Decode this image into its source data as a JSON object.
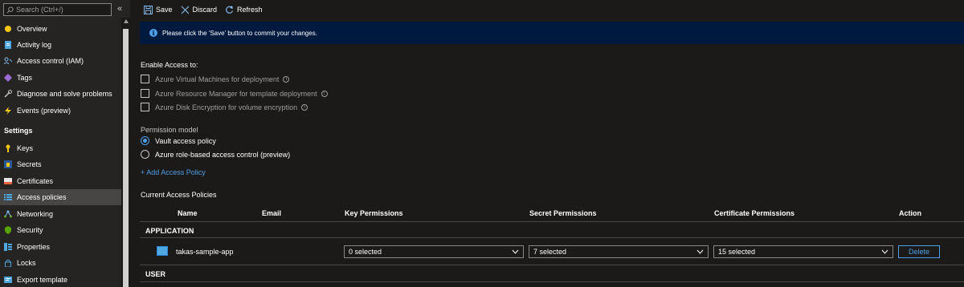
{
  "sidebar": {
    "search_placeholder": "Search (Ctrl+/)",
    "collapse_glyph": "«",
    "items": [
      {
        "label": "Overview",
        "icon": "overview-icon"
      },
      {
        "label": "Activity log",
        "icon": "activity-log-icon"
      },
      {
        "label": "Access control (IAM)",
        "icon": "iam-icon"
      },
      {
        "label": "Tags",
        "icon": "tag-icon"
      },
      {
        "label": "Diagnose and solve problems",
        "icon": "wrench-icon"
      },
      {
        "label": "Events (preview)",
        "icon": "lightning-icon"
      }
    ],
    "settings_heading": "Settings",
    "settings_items": [
      {
        "label": "Keys",
        "icon": "key-icon"
      },
      {
        "label": "Secrets",
        "icon": "secret-icon"
      },
      {
        "label": "Certificates",
        "icon": "certificate-icon"
      },
      {
        "label": "Access policies",
        "icon": "access-policies-icon",
        "active": true
      },
      {
        "label": "Networking",
        "icon": "networking-icon"
      },
      {
        "label": "Security",
        "icon": "shield-icon"
      },
      {
        "label": "Properties",
        "icon": "properties-icon"
      },
      {
        "label": "Locks",
        "icon": "lock-icon"
      },
      {
        "label": "Export template",
        "icon": "export-icon"
      }
    ]
  },
  "toolbar": {
    "save_label": "Save",
    "discard_label": "Discard",
    "refresh_label": "Refresh"
  },
  "info": {
    "message": "Please click the 'Save' button to commit your changes."
  },
  "enable_access": {
    "heading": "Enable Access to:",
    "options": [
      "Azure Virtual Machines for deployment",
      "Azure Resource Manager for template deployment",
      "Azure Disk Encryption for volume encryption"
    ]
  },
  "permission_model": {
    "heading": "Permission model",
    "options": [
      {
        "label": "Vault access policy",
        "selected": true
      },
      {
        "label": "Azure role-based access control (preview)",
        "selected": false
      }
    ]
  },
  "add_policy_link": "+ Add Access Policy",
  "policies": {
    "heading": "Current Access Policies",
    "columns": [
      "Name",
      "Email",
      "Key Permissions",
      "Secret Permissions",
      "Certificate Permissions",
      "Action"
    ],
    "groups": {
      "application": "APPLICATION",
      "user": "USER"
    },
    "rows": [
      {
        "name": "takas-sample-app",
        "key_permissions": "0 selected",
        "secret_permissions": "7 selected",
        "certificate_permissions": "15 selected",
        "action": "Delete"
      }
    ]
  },
  "colors": {
    "background": "#1b1a19",
    "sidebar": "#252423",
    "active_item": "#484644",
    "info_bar": "#00193f",
    "accent": "#4f9fe8"
  }
}
